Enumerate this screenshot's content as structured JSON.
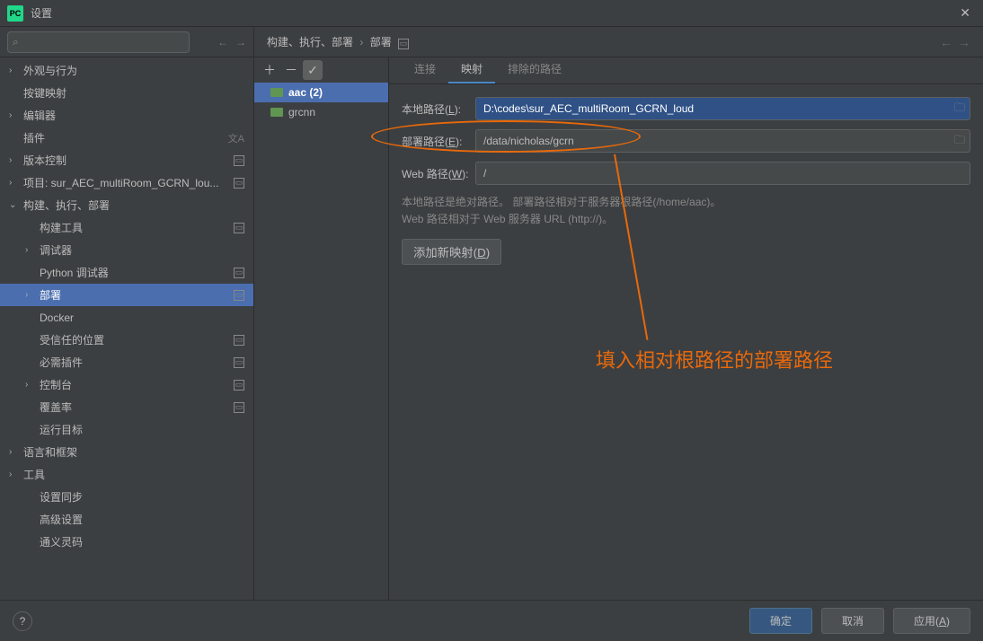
{
  "window": {
    "title": "设置",
    "pc": "PC"
  },
  "search": {
    "placeholder": ""
  },
  "sidebar": {
    "items": [
      {
        "label": "外观与行为",
        "chev": "›"
      },
      {
        "label": "按键映射"
      },
      {
        "label": "编辑器",
        "chev": "›"
      },
      {
        "label": "插件",
        "lang": "⅄"
      },
      {
        "label": "版本控制",
        "chev": "›",
        "badge": "▭"
      },
      {
        "label": "项目: sur_AEC_multiRoom_GCRN_lou...",
        "chev": "›",
        "badge": "▭"
      },
      {
        "label": "构建、执行、部署",
        "chev": "⌄"
      },
      {
        "label": "构建工具",
        "lvl": 1,
        "badge": "▭"
      },
      {
        "label": "调试器",
        "lvl": 1,
        "chev": "›"
      },
      {
        "label": "Python 调试器",
        "lvl": 1,
        "badge": "▭"
      },
      {
        "label": "部署",
        "lvl": 1,
        "chev": "›",
        "badge": "▭",
        "selected": true
      },
      {
        "label": "Docker",
        "lvl": 1
      },
      {
        "label": "受信任的位置",
        "lvl": 1,
        "badge": "▭"
      },
      {
        "label": "必需插件",
        "lvl": 1,
        "badge": "▭"
      },
      {
        "label": "控制台",
        "lvl": 1,
        "chev": "›",
        "badge": "▭"
      },
      {
        "label": "覆盖率",
        "lvl": 1,
        "badge": "▭"
      },
      {
        "label": "运行目标",
        "lvl": 1
      },
      {
        "label": "语言和框架",
        "chev": "›"
      },
      {
        "label": "工具",
        "chev": "›"
      },
      {
        "label": "设置同步",
        "lvl": 1
      },
      {
        "label": "高级设置",
        "lvl": 1
      },
      {
        "label": "通义灵码",
        "lvl": 1
      }
    ]
  },
  "breadcrumb": {
    "a": "构建、执行、部署",
    "b": "部署"
  },
  "servers": {
    "items": [
      {
        "label": "aac (2)",
        "selected": true
      },
      {
        "label": "grcnn"
      }
    ]
  },
  "tabs": {
    "a": "连接",
    "b": "映射",
    "c": "排除的路径",
    "active": "b"
  },
  "form": {
    "local_label_pre": "本地路径(",
    "local_u": "L",
    "local_label_post": "):",
    "local_value": "D:\\codes\\sur_AEC_multiRoom_GCRN_loud",
    "deploy_label_pre": "部署路径(",
    "deploy_u": "E",
    "deploy_label_post": "):",
    "deploy_value": "/data/nicholas/gcrn",
    "web_label_pre": "Web 路径(",
    "web_u": "W",
    "web_label_post": "):",
    "web_value": "/",
    "help1": "本地路径是绝对路径。 部署路径相对于服务器根路径(/home/aac)。",
    "help2": "Web 路径相对于 Web 服务器 URL (http://)。",
    "add_pre": "添加新映射(",
    "add_u": "D",
    "add_post": ")"
  },
  "annotation": {
    "text": "填入相对根路径的部署路径"
  },
  "footer": {
    "ok": "确定",
    "cancel": "取消",
    "apply_pre": "应用(",
    "apply_u": "A",
    "apply_post": ")"
  }
}
